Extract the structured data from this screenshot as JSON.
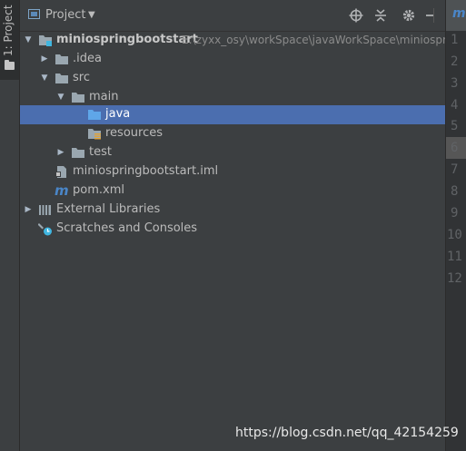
{
  "tool_window": {
    "label": "1: Project"
  },
  "header": {
    "title": "Project"
  },
  "tree": [
    {
      "id": "root",
      "label": "miniospringbootstart",
      "path": "E:\\zyxx_osy\\workSpace\\javaWorkSpace\\miniosprin",
      "expanded": true,
      "icon": "module-folder-icon"
    },
    {
      "id": "idea",
      "label": ".idea",
      "expanded": false,
      "icon": "folder-icon"
    },
    {
      "id": "src",
      "label": "src",
      "expanded": true,
      "icon": "folder-icon"
    },
    {
      "id": "main",
      "label": "main",
      "expanded": true,
      "icon": "folder-icon"
    },
    {
      "id": "java",
      "label": "java",
      "selected": true,
      "icon": "source-folder-icon"
    },
    {
      "id": "resources",
      "label": "resources",
      "icon": "resources-folder-icon"
    },
    {
      "id": "test",
      "label": "test",
      "expanded": false,
      "icon": "folder-icon"
    },
    {
      "id": "iml",
      "label": "miniospringbootstart.iml",
      "icon": "iml-file-icon"
    },
    {
      "id": "pom",
      "label": "pom.xml",
      "icon": "maven-file-icon"
    },
    {
      "id": "extlib",
      "label": "External Libraries",
      "expanded": false,
      "icon": "libraries-icon"
    },
    {
      "id": "scratches",
      "label": "Scratches and Consoles",
      "icon": "scratches-icon"
    }
  ],
  "editor": {
    "tab_icon": "m",
    "line_numbers": [
      "1",
      "2",
      "3",
      "4",
      "5",
      "6",
      "7",
      "8",
      "9",
      "10",
      "11",
      "12"
    ],
    "current_line": "6"
  },
  "watermark": "https://blog.csdn.net/qq_42154259",
  "colors": {
    "background": "#3c3f41",
    "selection": "#4b6eaf",
    "folder": "#9aa7b0",
    "source_folder": "#4f8fcf",
    "maven": "#4a86c8"
  }
}
